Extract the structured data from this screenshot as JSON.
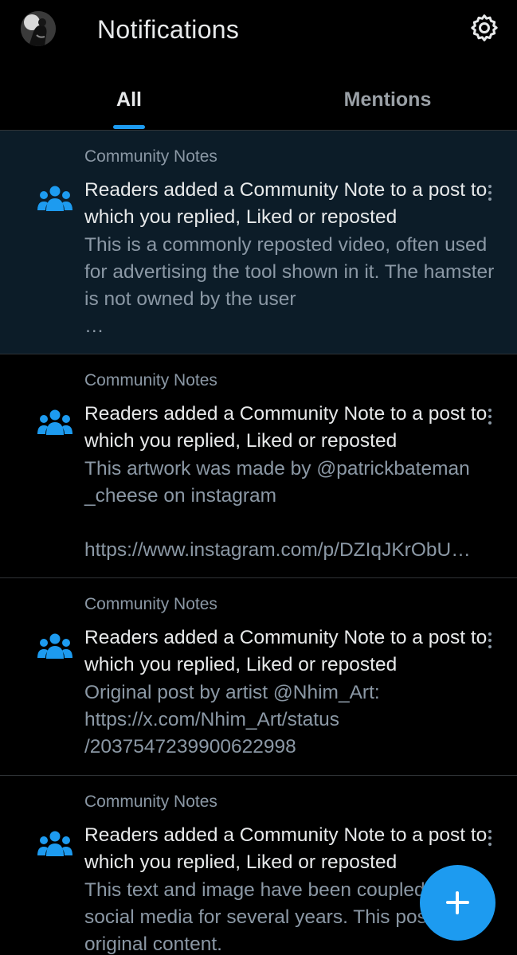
{
  "header": {
    "title": "Notifications"
  },
  "tabs": [
    {
      "label": "All",
      "selected": true
    },
    {
      "label": "Mentions",
      "selected": false
    }
  ],
  "notifications": [
    {
      "source": "Community Notes",
      "headline": "Readers added a Community Note to a post to which you replied, Liked or reposted",
      "body": "This is a commonly reposted video, often used for advertising the tool shown in it. The hamster is not owned by the user\n…",
      "unread": true,
      "icon": "community-notes-icon"
    },
    {
      "source": "Community Notes",
      "headline": "Readers added a Community Note to a post to which you replied, Liked or reposted",
      "body": "This artwork was made by @patrickbateman\n_cheese on instagram\n\nhttps://www.instagram.com/p/DZIqJKrObU…",
      "unread": false,
      "icon": "community-notes-icon"
    },
    {
      "source": "Community Notes",
      "headline": "Readers added a Community Note to a post to which you replied, Liked or reposted",
      "body": "Original post by artist @Nhim_Art:\nhttps://x.com/Nhim_Art/status\n/2037547239900622998",
      "unread": false,
      "icon": "community-notes-icon"
    },
    {
      "source": "Community Notes",
      "headline": "Readers added a Community Note to a post to which you replied, Liked or reposted",
      "body": "This text and image have been coupled on social media for several years. This post is not original content.",
      "unread": false,
      "icon": "community-notes-icon"
    }
  ],
  "fab": {
    "icon": "plus-icon"
  },
  "colors": {
    "accent": "#1d9bf0",
    "unread_bg": "#0c1c28",
    "muted": "#8b98a5"
  }
}
